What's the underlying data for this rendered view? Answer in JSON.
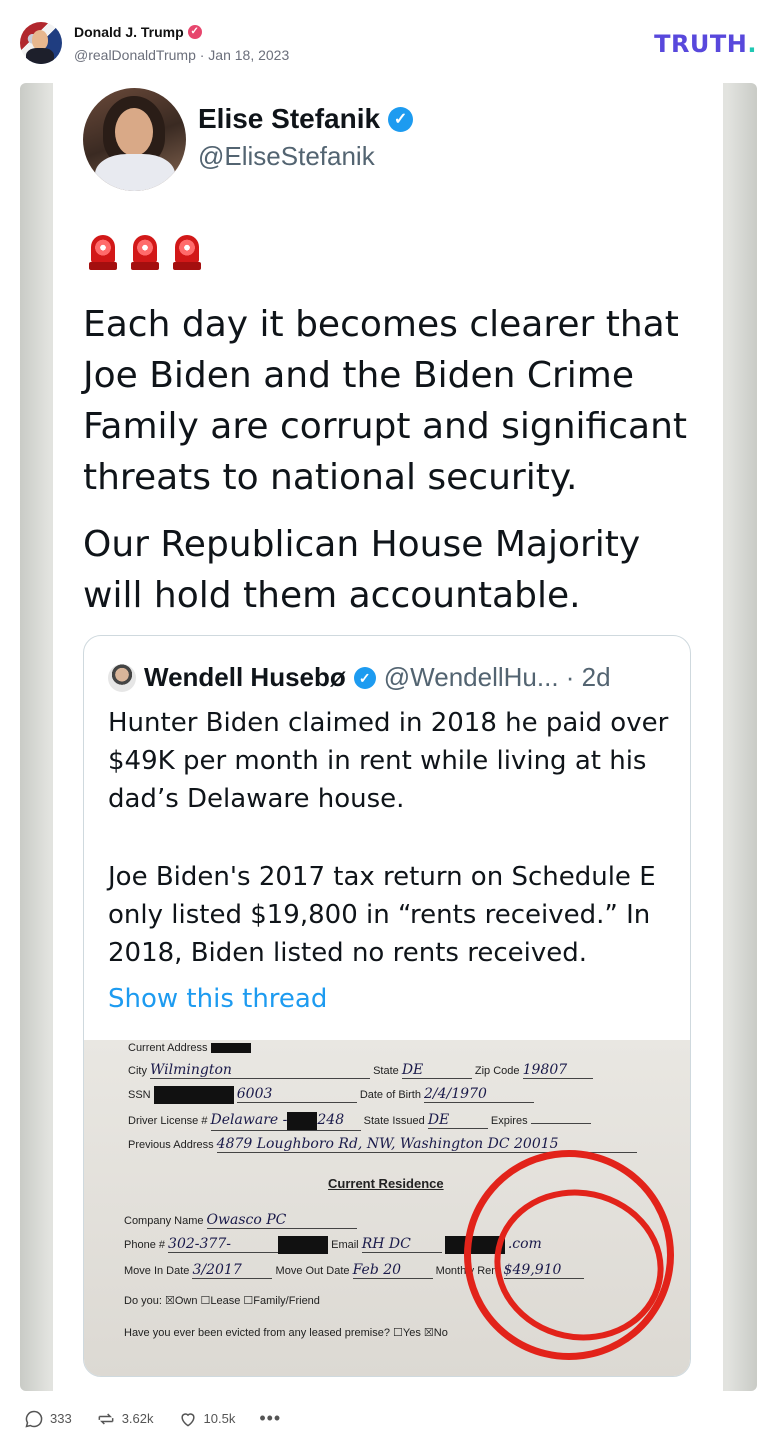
{
  "post": {
    "display_name": "Donald J. Trump",
    "handle_line": "@realDonaldTrump · Jan 18, 2023",
    "logo_text": "TRUTH",
    "logo_dot": "."
  },
  "tweet": {
    "name": "Elise Stefanik",
    "handle": "@EliseStefanik",
    "emoji_label": "🚨🚨🚨",
    "paragraph1": "Each day it becomes clearer that Joe Biden and the Biden Crime Family are corrupt and significant threats to national security.",
    "paragraph2": "Our Republican House Majority will hold them accountable."
  },
  "quote": {
    "name": "Wendell Husebø",
    "handle_time": "@WendellHu... · 2d",
    "text1": "Hunter Biden claimed in 2018 he paid over $49K per month in rent while living at his dad’s Delaware house.",
    "text2": "Joe Biden's 2017 tax return on Schedule E only listed $19,800 in “rents received.” In 2018, Biden listed no rents received.",
    "show_thread": "Show this thread"
  },
  "form": {
    "current_address_label": "Current Address",
    "city_label": "City",
    "city_value": "Wilmington",
    "state_label": "State",
    "state_value": "DE",
    "zip_label": "Zip Code",
    "zip_value": "19807",
    "ssn_label": "SSN",
    "ssn_value": "6003",
    "dob_label": "Date of Birth",
    "dob_value": "2/4/1970",
    "dl_label": "Driver License #",
    "dl_value": "Delaware -",
    "dl_value2": "248",
    "state_issued_label": "State Issued",
    "state_issued_value": "DE",
    "expires_label": "Expires",
    "prev_address_label": "Previous Address",
    "prev_address_value": "4879 Loughboro Rd, NW, Washington DC 20015",
    "current_residence": "Current Residence",
    "company_label": "Company Name",
    "company_value": "Owasco PC",
    "phone_label": "Phone #",
    "phone_value": "302-377-",
    "email_label": "Email",
    "email_value": "RH DC",
    "email_suffix": ".com",
    "move_in_label": "Move In Date",
    "move_in_value": "3/2017",
    "move_out_label": "Move Out Date",
    "move_out_value": "Feb 20",
    "rent_label": "Monthly Rent",
    "rent_value": "$49,910",
    "do_you_label": "Do you:",
    "own_label": "Own",
    "lease_label": "Lease",
    "family_label": "Family/Friend",
    "evicted_label": "Have you ever been evicted from any leased premise?",
    "yes_label": "Yes",
    "no_label": "No"
  },
  "actions": {
    "replies": "333",
    "retruths": "3.62k",
    "likes": "10.5k",
    "more": "•••"
  }
}
